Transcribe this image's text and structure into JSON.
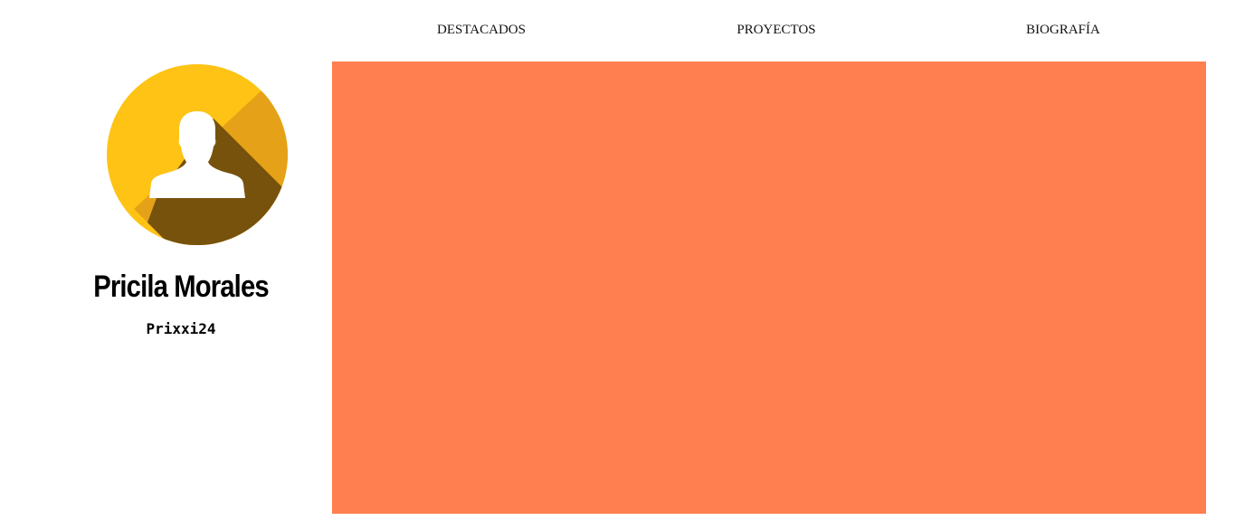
{
  "nav": {
    "items": [
      {
        "label": "DESTACADOS"
      },
      {
        "label": "PROYECTOS"
      },
      {
        "label": "BIOGRAFÍA"
      }
    ]
  },
  "profile": {
    "name": "Pricila Morales",
    "username": "Prixxi24",
    "avatar_icon": "user-silhouette-icon"
  },
  "colors": {
    "content_panel": "#ff7f50",
    "avatar_primary": "#fec314",
    "avatar_shadow": "#e5a218",
    "avatar_dark_shadow": "#76520c",
    "silhouette": "#ffffff"
  }
}
